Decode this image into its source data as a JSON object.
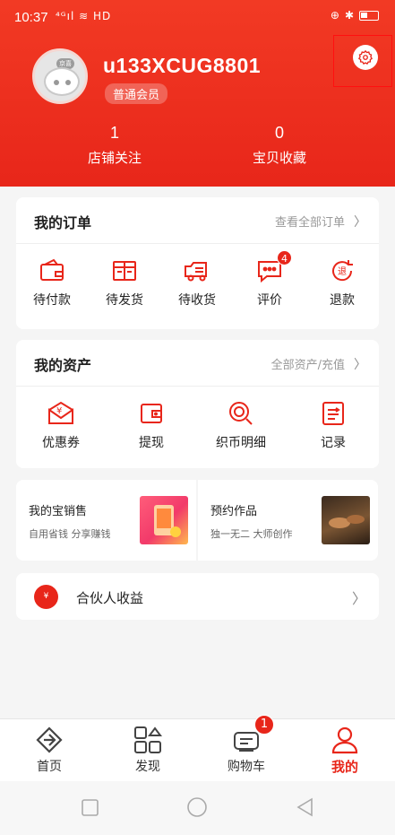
{
  "status_bar": {
    "time": "10:37",
    "signal_text": "⁴ᴳıl",
    "hd_text": "HD"
  },
  "profile": {
    "username": "u133XCUG8801",
    "member_level": "普通会员",
    "avatar_tag": "京喜"
  },
  "stats": [
    {
      "value": "1",
      "label": "店铺关注"
    },
    {
      "value": "0",
      "label": "宝贝收藏"
    }
  ],
  "orders": {
    "title": "我的订单",
    "view_all": "查看全部订单",
    "items": [
      {
        "label": "待付款",
        "icon": "wallet-icon"
      },
      {
        "label": "待发货",
        "icon": "package-icon"
      },
      {
        "label": "待收货",
        "icon": "truck-icon"
      },
      {
        "label": "评价",
        "icon": "comment-icon",
        "badge": "4"
      },
      {
        "label": "退款",
        "icon": "refund-icon"
      }
    ]
  },
  "assets": {
    "title": "我的资产",
    "view_all": "全部资产/充值",
    "items": [
      {
        "label": "优惠券",
        "icon": "coupon-envelope-icon"
      },
      {
        "label": "提现",
        "icon": "wallet-withdraw-icon"
      },
      {
        "label": "织币明细",
        "icon": "coin-search-icon"
      },
      {
        "label": "记录",
        "icon": "record-icon"
      }
    ]
  },
  "promos": [
    {
      "title": "我的宝销售",
      "subtitle": "自用省钱  分享赚钱"
    },
    {
      "title": "预约作品",
      "subtitle": "独一无二  大师创作"
    }
  ],
  "partner": {
    "label": "合伙人收益",
    "icon_text": "¥"
  },
  "tabbar": {
    "items": [
      {
        "label": "首页",
        "icon": "home-logo-icon"
      },
      {
        "label": "发现",
        "icon": "discover-grid-icon"
      },
      {
        "label": "购物车",
        "icon": "cart-icon",
        "badge": "1"
      },
      {
        "label": "我的",
        "icon": "profile-icon",
        "active": true
      }
    ]
  },
  "colors": {
    "brand": "#e8261a",
    "background": "#f5f5f5"
  }
}
